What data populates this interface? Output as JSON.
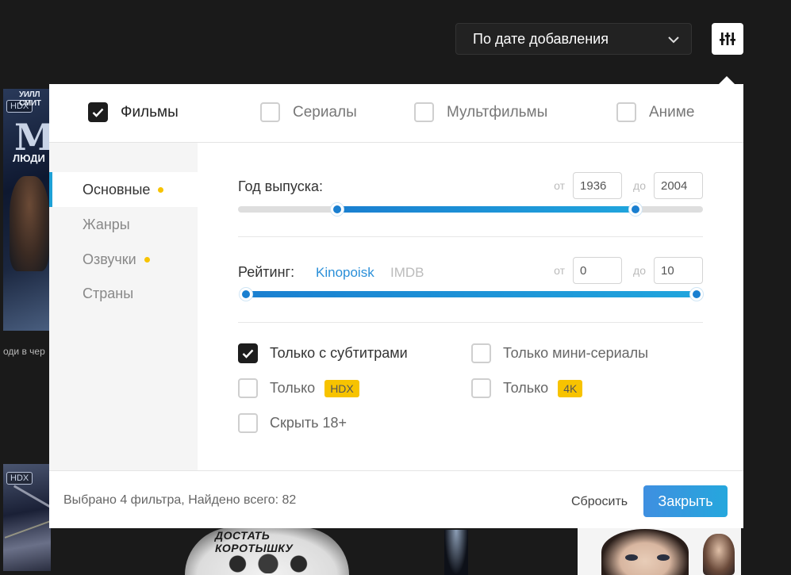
{
  "background": {
    "posters": [
      {
        "badge": "HDX",
        "title_top": "УИЛЛ СМИТ",
        "title_big": "M",
        "title_sub": "ЛЮДИ",
        "caption": "оди в чер"
      },
      {
        "badge": "HDX"
      },
      {
        "title": "ДОСТАТЬ КОРОТЫШКУ"
      }
    ]
  },
  "sort": {
    "selected": "По дате добавления"
  },
  "panel": {
    "types": [
      {
        "label": "Фильмы",
        "checked": true
      },
      {
        "label": "Сериалы",
        "checked": false
      },
      {
        "label": "Мультфильмы",
        "checked": false
      },
      {
        "label": "Аниме",
        "checked": false
      }
    ],
    "sidebar": [
      {
        "label": "Основные",
        "active": true,
        "dot": true
      },
      {
        "label": "Жанры",
        "active": false,
        "dot": false
      },
      {
        "label": "Озвучки",
        "active": false,
        "dot": true
      },
      {
        "label": "Страны",
        "active": false,
        "dot": false
      }
    ],
    "year": {
      "label": "Год выпуска:",
      "from_label": "от",
      "to_label": "до",
      "from": "1936",
      "to": "2004",
      "from_fraction": 0.213,
      "to_fraction": 0.855
    },
    "rating": {
      "label": "Рейтинг:",
      "sources": [
        "Kinopoisk",
        "IMDB"
      ],
      "active_source": "Kinopoisk",
      "from_label": "от",
      "to_label": "до",
      "from": "0",
      "to": "10",
      "from_fraction": 0.0,
      "to_fraction": 1.0
    },
    "options": {
      "subtitles": {
        "label": "Только с субтитрами",
        "checked": true
      },
      "mini_series": {
        "label": "Только мини-сериалы",
        "checked": false
      },
      "only_hdx": {
        "label": "Только",
        "tag": "HDX",
        "checked": false
      },
      "only_4k": {
        "label": "Только",
        "tag": "4K",
        "checked": false
      },
      "hide_18": {
        "label": "Скрыть 18+",
        "checked": false
      }
    },
    "footer": {
      "info": "Выбрано 4 фильтра, Найдено всего: 82",
      "reset": "Сбросить",
      "close": "Закрыть"
    }
  },
  "colors": {
    "accent": "#1a7fd0",
    "tag": "#f7c300",
    "link": "#2a8fd8"
  }
}
